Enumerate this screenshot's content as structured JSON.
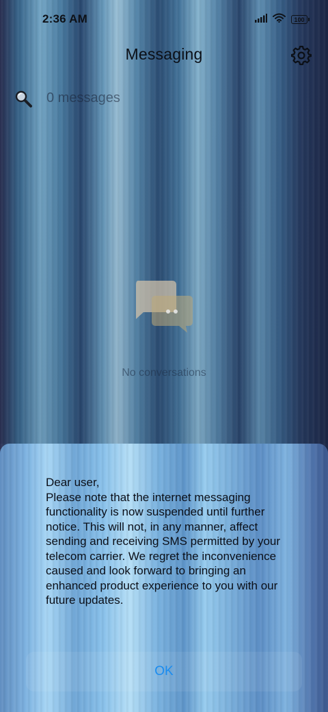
{
  "status_bar": {
    "time": "2:36 AM",
    "battery": "100",
    "icons": [
      "signal-icon",
      "wifi-icon",
      "battery-icon"
    ]
  },
  "header": {
    "title": "Messaging",
    "settings_icon": "gear-icon"
  },
  "search": {
    "placeholder": "0 messages",
    "icon": "search-icon"
  },
  "empty_state": {
    "icon": "chat-bubbles-icon",
    "text": "No conversations"
  },
  "dialog": {
    "message": "Dear user,\nPlease note that the internet messaging functionality is now suspended until further notice. This will not, in any manner, affect sending and receiving SMS permitted by your telecom carrier. We regret the inconvenience caused and look forward to bringing an enhanced product experience to you with our future updates.",
    "ok_label": "OK"
  },
  "colors": {
    "accent": "#1a8cf0",
    "text_dark": "#0b0f16"
  }
}
